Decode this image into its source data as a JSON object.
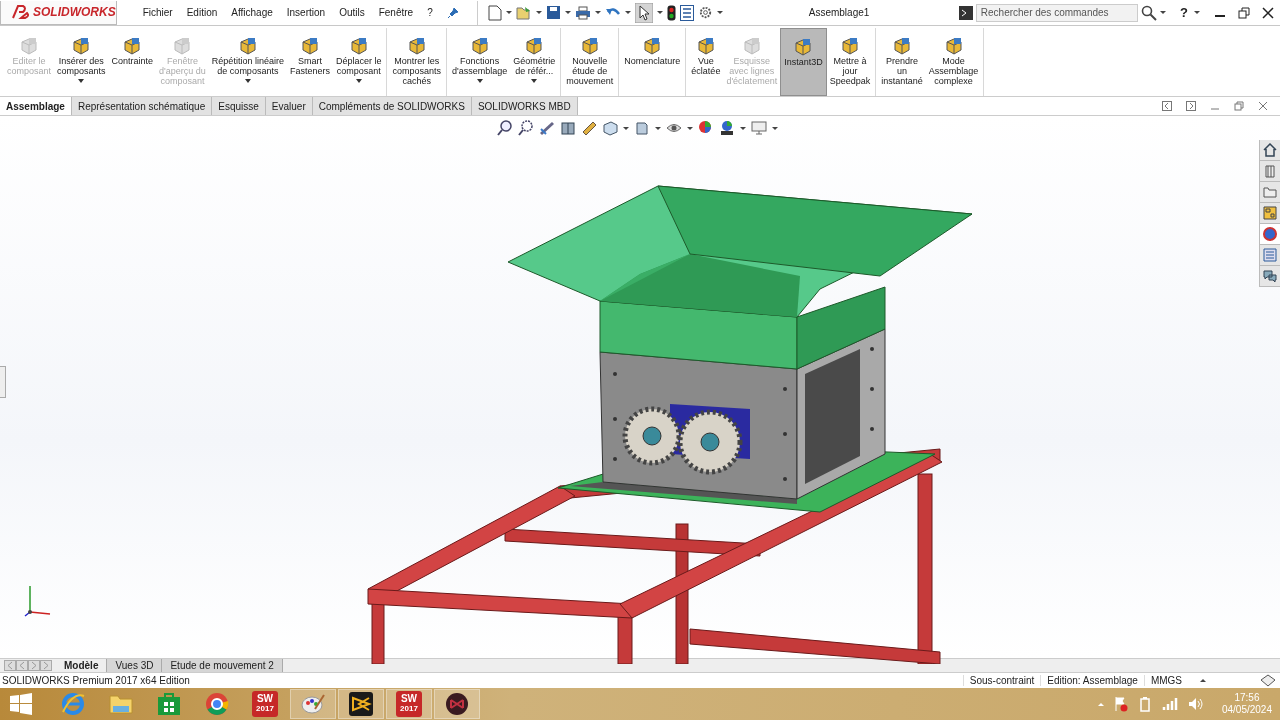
{
  "app": {
    "brand": "SOLIDWORKS",
    "menu": [
      "Fichier",
      "Edition",
      "Affichage",
      "Insertion",
      "Outils",
      "Fenêtre",
      "?"
    ],
    "document_title": "Assemblage1",
    "search": {
      "placeholder": "Rechercher des commandes"
    },
    "help": "?"
  },
  "ribbon": {
    "groups": [
      {
        "commands": [
          {
            "lines": [
              "Editer le",
              "composant"
            ],
            "disabled": true,
            "dropdown": false,
            "selected": false
          },
          {
            "lines": [
              "Insérer des",
              "composants"
            ],
            "disabled": false,
            "dropdown": true,
            "selected": false
          },
          {
            "lines": [
              "Contrainte"
            ],
            "disabled": false,
            "dropdown": false,
            "selected": false
          },
          {
            "lines": [
              "Fenêtre",
              "d'aperçu du",
              "composant"
            ],
            "disabled": true,
            "dropdown": false,
            "selected": false
          },
          {
            "lines": [
              "Répétition linéaire",
              "de composants"
            ],
            "disabled": false,
            "dropdown": true,
            "selected": false
          },
          {
            "lines": [
              "Smart",
              "Fasteners"
            ],
            "disabled": false,
            "dropdown": false,
            "selected": false
          },
          {
            "lines": [
              "Déplacer le",
              "composant"
            ],
            "disabled": false,
            "dropdown": true,
            "selected": false
          }
        ]
      },
      {
        "commands": [
          {
            "lines": [
              "Montrer les",
              "composants",
              "cachés"
            ],
            "disabled": false,
            "dropdown": false,
            "selected": false
          }
        ]
      },
      {
        "commands": [
          {
            "lines": [
              "Fonctions",
              "d'assemblage"
            ],
            "disabled": false,
            "dropdown": true,
            "selected": false
          },
          {
            "lines": [
              "Géométrie",
              "de référ..."
            ],
            "disabled": false,
            "dropdown": true,
            "selected": false
          }
        ]
      },
      {
        "commands": [
          {
            "lines": [
              "Nouvelle",
              "étude de",
              "mouvement"
            ],
            "disabled": false,
            "dropdown": false,
            "selected": false
          }
        ]
      },
      {
        "commands": [
          {
            "lines": [
              "Nomenclature"
            ],
            "disabled": false,
            "dropdown": false,
            "selected": false
          }
        ]
      },
      {
        "commands": [
          {
            "lines": [
              "Vue",
              "éclatée"
            ],
            "disabled": false,
            "dropdown": false,
            "selected": false
          },
          {
            "lines": [
              "Esquisse",
              "avec lignes",
              "d'éclatement"
            ],
            "disabled": true,
            "dropdown": false,
            "selected": false
          },
          {
            "lines": [
              "Instant3D"
            ],
            "disabled": false,
            "dropdown": false,
            "selected": true
          },
          {
            "lines": [
              "Mettre à",
              "jour",
              "Speedpak"
            ],
            "disabled": false,
            "dropdown": false,
            "selected": false
          }
        ]
      },
      {
        "commands": [
          {
            "lines": [
              "Prendre",
              "un",
              "instantané"
            ],
            "disabled": false,
            "dropdown": false,
            "selected": false
          },
          {
            "lines": [
              "Mode",
              "Assemblage",
              "complexe"
            ],
            "disabled": false,
            "dropdown": false,
            "selected": false
          }
        ]
      }
    ]
  },
  "tabs": [
    {
      "label": "Assemblage",
      "selected": true
    },
    {
      "label": "Représentation schématique",
      "selected": false
    },
    {
      "label": "Esquisse",
      "selected": false
    },
    {
      "label": "Evaluer",
      "selected": false
    },
    {
      "label": "Compléments de SOLIDWORKS",
      "selected": false
    },
    {
      "label": "SOLIDWORKS MBD",
      "selected": false
    }
  ],
  "bottom_tabs": [
    {
      "label": "Modèle",
      "selected": true
    },
    {
      "label": "Vues 3D",
      "selected": false
    },
    {
      "label": "Etude de mouvement 2",
      "selected": false
    }
  ],
  "status_bar": {
    "product": "SOLIDWORKS Premium 2017 x64 Edition",
    "cells": [
      "Sous-contraint",
      "Edition: Assemblage",
      "MMGS"
    ]
  },
  "taskbar": {
    "apps": [
      {
        "kind": "ie",
        "running": false
      },
      {
        "kind": "folder",
        "running": false
      },
      {
        "kind": "store",
        "running": false
      },
      {
        "kind": "chrome",
        "running": false
      },
      {
        "kind": "solidworks",
        "text": "SW",
        "badge": "2017",
        "running": false
      },
      {
        "kind": "paint",
        "running": true
      },
      {
        "kind": "vee",
        "running": true
      },
      {
        "kind": "solidworks",
        "text": "SW",
        "badge": "2017",
        "running": true
      },
      {
        "kind": "redcircle",
        "running": true
      }
    ],
    "time": "17:56",
    "date": "04/05/2024"
  }
}
